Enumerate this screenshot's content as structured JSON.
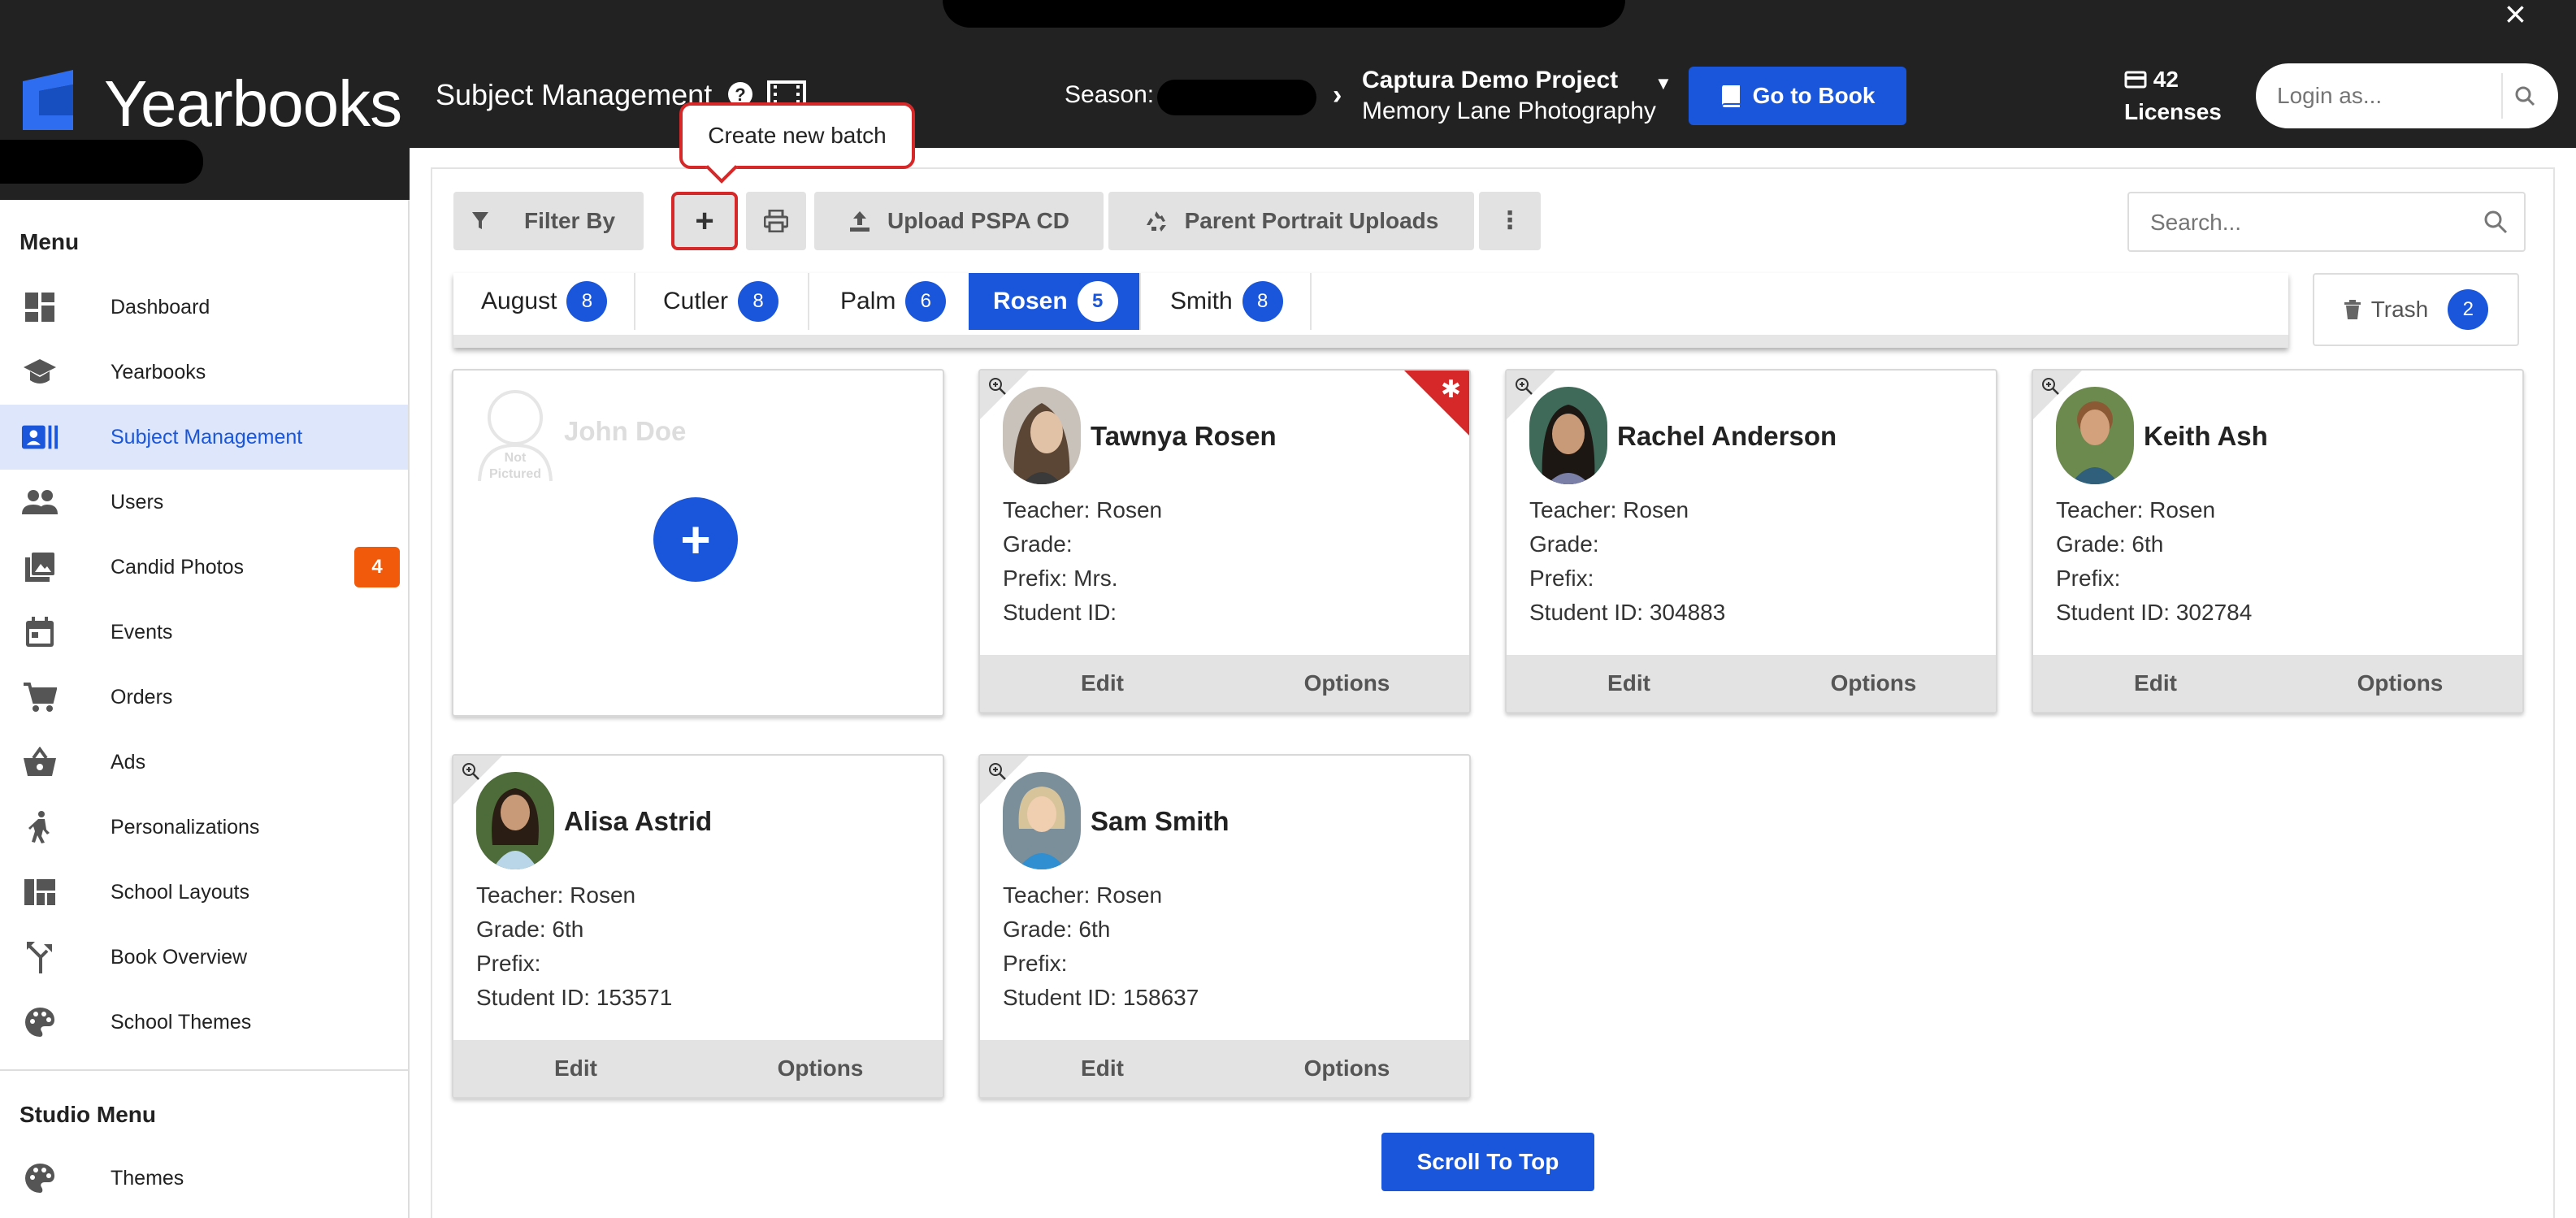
{
  "brand": {
    "name": "Yearbooks"
  },
  "sidebar": {
    "menu_heading": "Menu",
    "items": [
      {
        "label": "Dashboard",
        "icon": "dashboard-icon"
      },
      {
        "label": "Yearbooks",
        "icon": "graduation-cap-icon"
      },
      {
        "label": "Subject Management",
        "icon": "id-card-icon",
        "active": true
      },
      {
        "label": "Users",
        "icon": "users-icon"
      },
      {
        "label": "Candid Photos",
        "icon": "photos-icon",
        "badge": "4"
      },
      {
        "label": "Events",
        "icon": "calendar-icon"
      },
      {
        "label": "Orders",
        "icon": "cart-icon"
      },
      {
        "label": "Ads",
        "icon": "basket-icon"
      },
      {
        "label": "Personalizations",
        "icon": "person-icon"
      },
      {
        "label": "School Layouts",
        "icon": "layout-icon"
      },
      {
        "label": "Book Overview",
        "icon": "fork-icon"
      },
      {
        "label": "School Themes",
        "icon": "palette-icon"
      }
    ],
    "studio_heading": "Studio Menu",
    "studio_items": [
      {
        "label": "Themes",
        "icon": "palette-icon"
      }
    ]
  },
  "header": {
    "title": "Subject Management",
    "season_label": "Season:",
    "project_title": "Captura Demo Project",
    "project_subtitle": "Memory Lane Photography",
    "go_to_book": "Go to Book",
    "licenses_count": "42",
    "licenses_label": "Licenses",
    "login_placeholder": "Login as..."
  },
  "toolbar": {
    "filter_label": "Filter By",
    "upload_label": "Upload PSPA CD",
    "parent_uploads_label": "Parent Portrait Uploads",
    "tooltip": "Create new batch",
    "search_placeholder": "Search..."
  },
  "tabs": [
    {
      "label": "August",
      "count": "8"
    },
    {
      "label": "Cutler",
      "count": "8"
    },
    {
      "label": "Palm",
      "count": "6"
    },
    {
      "label": "Rosen",
      "count": "5",
      "active": true
    },
    {
      "label": "Smith",
      "count": "8"
    }
  ],
  "trash": {
    "label": "Trash",
    "count": "2"
  },
  "placeholder_card": {
    "name": "John Doe",
    "not_pictured": "Not Pictured"
  },
  "students": [
    {
      "name": "Tawnya Rosen",
      "teacher": "Teacher: Rosen",
      "grade": "Grade:",
      "prefix": "Prefix: Mrs.",
      "student_id": "Student ID:",
      "flagged": true
    },
    {
      "name": "Rachel Anderson",
      "teacher": "Teacher: Rosen",
      "grade": "Grade:",
      "prefix": "Prefix:",
      "student_id": "Student ID: 304883"
    },
    {
      "name": "Keith Ash",
      "teacher": "Teacher: Rosen",
      "grade": "Grade: 6th",
      "prefix": "Prefix:",
      "student_id": "Student ID: 302784"
    },
    {
      "name": "Alisa Astrid",
      "teacher": "Teacher: Rosen",
      "grade": "Grade: 6th",
      "prefix": "Prefix:",
      "student_id": "Student ID: 153571"
    },
    {
      "name": "Sam Smith",
      "teacher": "Teacher: Rosen",
      "grade": "Grade: 6th",
      "prefix": "Prefix:",
      "student_id": "Student ID: 158637"
    }
  ],
  "card_actions": {
    "edit": "Edit",
    "options": "Options"
  },
  "scroll_to_top": "Scroll To Top",
  "colors": {
    "accent": "#1a56db",
    "header": "#222222",
    "flag": "#d62828",
    "badge": "#f05a0a"
  }
}
